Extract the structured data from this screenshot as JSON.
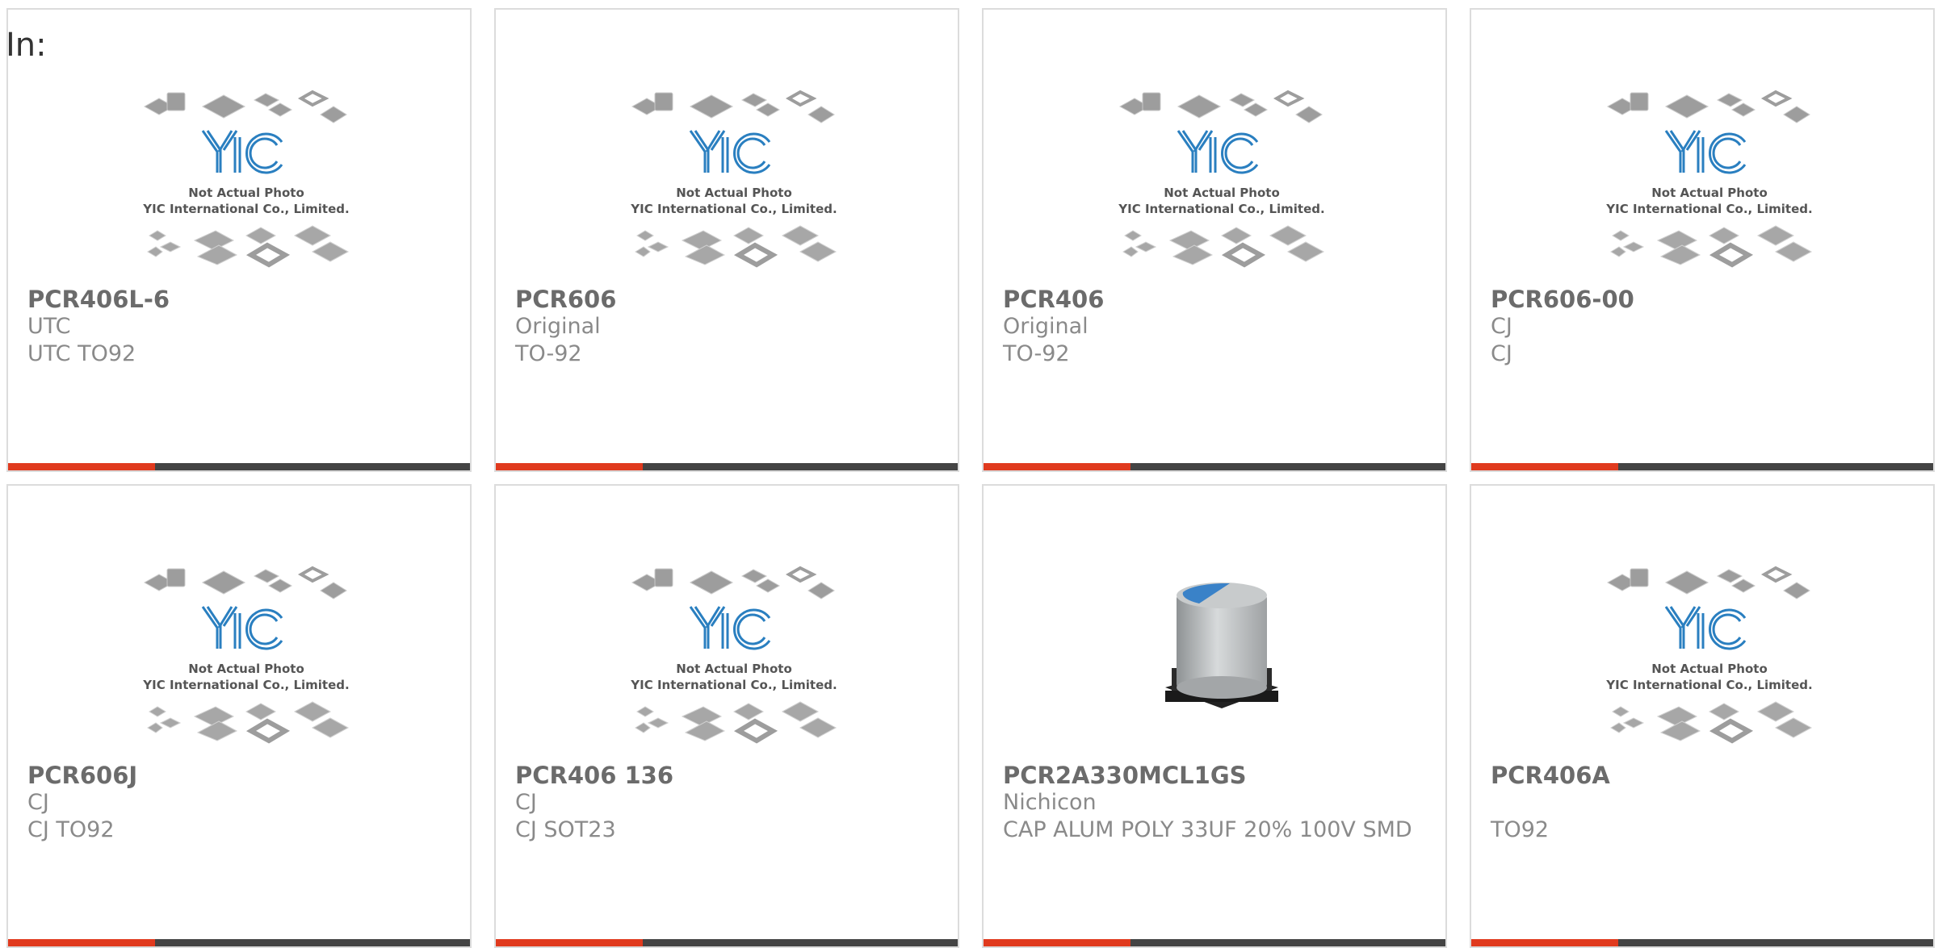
{
  "page": {
    "in_label": "In:"
  },
  "placeholder_image": {
    "logo": "YIC",
    "caption_line1": "Not Actual Photo",
    "caption_line2": "YIC International Co., Limited."
  },
  "products": [
    {
      "part_number": "PCR406L-6",
      "manufacturer": "UTC",
      "description": "UTC TO92",
      "image": "placeholder"
    },
    {
      "part_number": "PCR606",
      "manufacturer": "Original",
      "description": "TO-92",
      "image": "placeholder"
    },
    {
      "part_number": "PCR406",
      "manufacturer": "Original",
      "description": "TO-92",
      "image": "placeholder"
    },
    {
      "part_number": "PCR606-00",
      "manufacturer": "CJ",
      "description": "CJ",
      "image": "placeholder"
    },
    {
      "part_number": "PCR606J",
      "manufacturer": "CJ",
      "description": "CJ TO92",
      "image": "placeholder"
    },
    {
      "part_number": "PCR406 136",
      "manufacturer": "CJ",
      "description": "CJ SOT23",
      "image": "placeholder"
    },
    {
      "part_number": "PCR2A330MCL1GS",
      "manufacturer": "Nichicon",
      "description": "CAP ALUM POLY 33UF 20% 100V SMD",
      "image": "capacitor-photo"
    },
    {
      "part_number": "PCR406A",
      "manufacturer": "",
      "description": "TO92",
      "image": "placeholder"
    }
  ],
  "colors": {
    "accent": "#e03a1e",
    "bar": "#444444",
    "logo_blue": "#2a7fc0",
    "text_gray": "#6b6b6b"
  }
}
